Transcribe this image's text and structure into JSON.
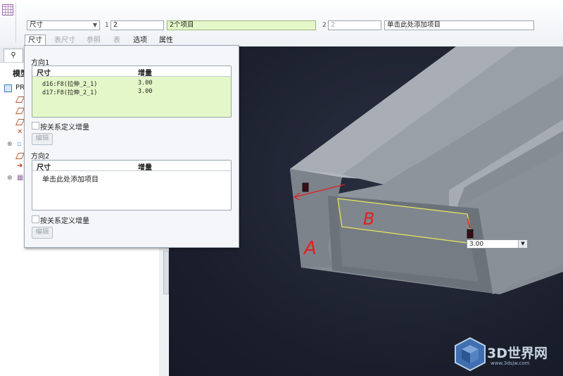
{
  "ribbon": {
    "type_select": "尺寸",
    "ref1_label": "1",
    "ref1_value": "2",
    "ref1_items": "2个项目",
    "ref2_label": "2",
    "ref2_value": "2",
    "ref2_items": "单击此处添加项目",
    "tabs": [
      "尺寸",
      "表尺寸",
      "参照",
      "表",
      "选项",
      "属性"
    ]
  },
  "tree": {
    "title": "模型",
    "root_label": "PR"
  },
  "panel": {
    "dir1_title": "方向1",
    "col_dim": "尺寸",
    "col_inc": "增量",
    "rows": [
      {
        "dim": "d16:F8(拉伸_2_1)",
        "inc": "3.00"
      },
      {
        "dim": "d17:F8(拉伸_2_1)",
        "inc": "3.00"
      }
    ],
    "relation_check1": "按关系定义增量",
    "edit1": "编辑",
    "dir2_title": "方向2",
    "dir2_add": "单击此处添加项目",
    "relation_check2": "按关系定义增量",
    "edit2": "编辑"
  },
  "viewport": {
    "value_box": "3.00",
    "annotation_a": "A",
    "annotation_b": "B"
  },
  "watermark": {
    "brand": "3D世界网",
    "url": "www.3dsjw.com"
  },
  "colors": {
    "highlight_green": "#e4f7c8",
    "selection_yellow": "#e8e85a",
    "annotation_red": "#e02020"
  }
}
